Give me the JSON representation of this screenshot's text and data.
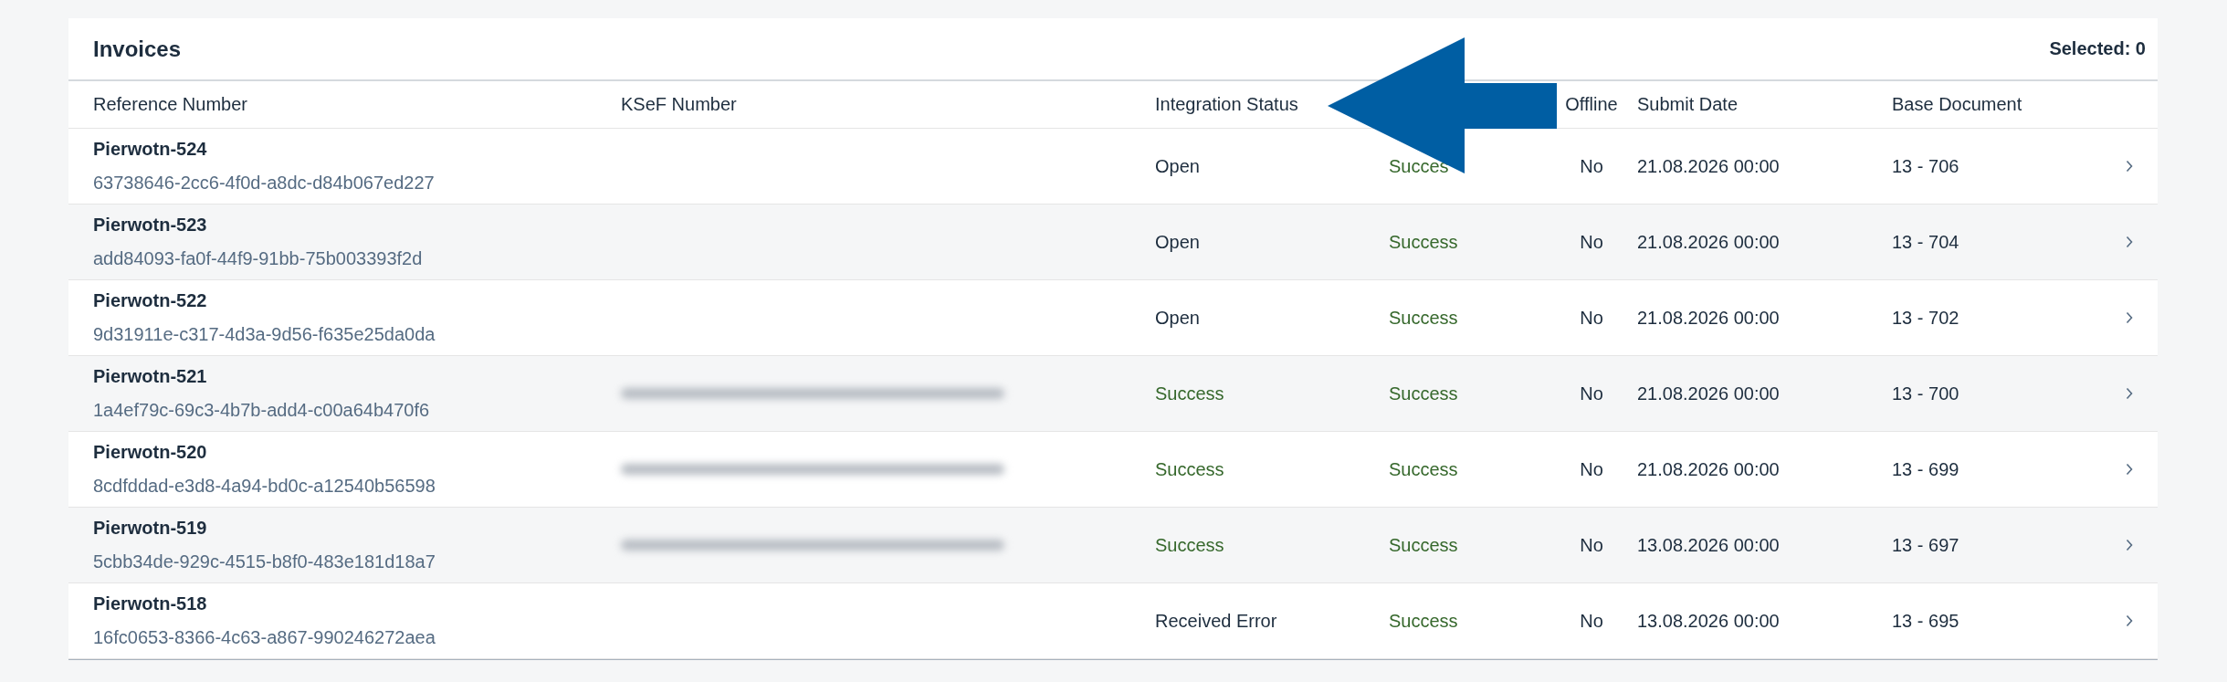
{
  "panel": {
    "title": "Invoices",
    "selection_info": "Selected: 0"
  },
  "columns": [
    "Reference Number",
    "KSeF Number",
    "Integration Status",
    "Offline",
    "Submit Date",
    "Base Document"
  ],
  "rows": [
    {
      "title": "Pierwotn-524",
      "reference": "63738646-2cc6-4f0d-a8dc-d84b067ed227",
      "ksef_blurred": false,
      "integration_status": {
        "text": "Open",
        "color": "#1d2d3e"
      },
      "column_4": "Succes",
      "offline": "No",
      "submit_date": "21.08.2026 00:00",
      "base_document": "13 - 706"
    },
    {
      "title": "Pierwotn-523",
      "reference": "add84093-fa0f-44f9-91bb-75b003393f2d",
      "ksef_blurred": false,
      "integration_status": {
        "text": "Open",
        "color": "#1d2d3e"
      },
      "column_4": "Success",
      "offline": "No",
      "submit_date": "21.08.2026 00:00",
      "base_document": "13 - 704"
    },
    {
      "title": "Pierwotn-522",
      "reference": "9d31911e-c317-4d3a-9d56-f635e25da0da",
      "ksef_blurred": false,
      "integration_status": {
        "text": "Open",
        "color": "#1d2d3e"
      },
      "column_4": "Success",
      "offline": "No",
      "submit_date": "21.08.2026 00:00",
      "base_document": "13 - 702"
    },
    {
      "title": "Pierwotn-521",
      "reference": "1a4ef79c-69c3-4b7b-add4-c00a64b470f6",
      "ksef_blurred": true,
      "integration_status": {
        "text": "Success",
        "color": "#36682c"
      },
      "column_4": "Success",
      "offline": "No",
      "submit_date": "21.08.2026 00:00",
      "base_document": "13 - 700"
    },
    {
      "title": "Pierwotn-520",
      "reference": "8cdfddad-e3d8-4a94-bd0c-a12540b56598",
      "ksef_blurred": true,
      "integration_status": {
        "text": "Success",
        "color": "#36682c"
      },
      "column_4": "Success",
      "offline": "No",
      "submit_date": "21.08.2026 00:00",
      "base_document": "13 - 699"
    },
    {
      "title": "Pierwotn-519",
      "reference": "5cbb34de-929c-4515-b8f0-483e181d18a7",
      "ksef_blurred": true,
      "integration_status": {
        "text": "Success",
        "color": "#36682c"
      },
      "column_4": "Success",
      "offline": "No",
      "submit_date": "13.08.2026 00:00",
      "base_document": "13 - 697"
    },
    {
      "title": "Pierwotn-518",
      "reference": "16fc0653-8366-4c63-a867-990246272aea",
      "ksef_blurred": false,
      "integration_status": {
        "text": "Received Error",
        "color": "#1d2d3e"
      },
      "column_4": "Success",
      "offline": "No",
      "submit_date": "13.08.2026 00:00",
      "base_document": "13 - 695"
    }
  ]
}
